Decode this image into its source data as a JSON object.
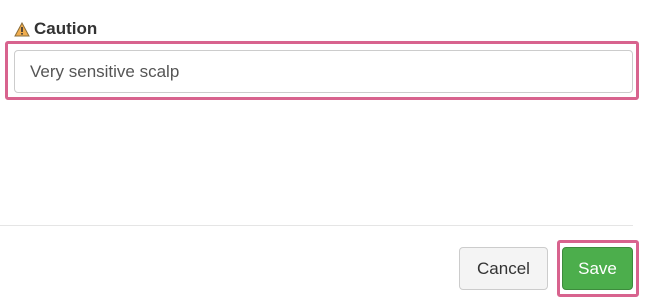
{
  "caution": {
    "title": "Caution",
    "icon": "warning-icon",
    "value": "Very sensitive scalp"
  },
  "actions": {
    "cancel_label": "Cancel",
    "save_label": "Save"
  },
  "colors": {
    "highlight": "#d8638e",
    "save_bg": "#4cae4c",
    "warning_fill": "#f0ad4e"
  }
}
